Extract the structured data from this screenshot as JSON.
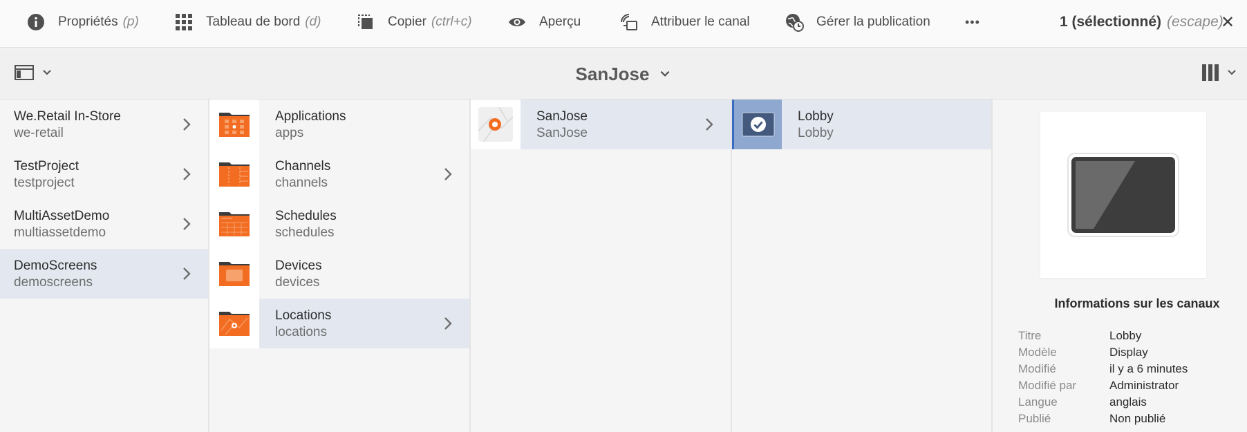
{
  "actionbar": {
    "properties": {
      "label": "Propriétés",
      "shortcut": "(p)",
      "icon": "info-icon"
    },
    "dashboard": {
      "label": "Tableau de bord",
      "shortcut": "(d)",
      "icon": "grid-icon"
    },
    "copy": {
      "label": "Copier",
      "shortcut": "(ctrl+c)",
      "icon": "copy-icon"
    },
    "preview": {
      "label": "Aperçu",
      "icon": "eye-icon"
    },
    "assign_channel": {
      "label": "Attribuer le canal",
      "icon": "assign-channel-icon"
    },
    "manage_publication": {
      "label": "Gérer la publication",
      "icon": "globe-clock-icon"
    },
    "more": {
      "label": "•••"
    },
    "selection": {
      "count": "1 (sélectionné)",
      "escape": "(escape)"
    },
    "close": {
      "label": "✕"
    }
  },
  "titlebar": {
    "title": "SanJose"
  },
  "columns": {
    "col1": [
      {
        "title": "We.Retail In-Store",
        "sub": "we-retail"
      },
      {
        "title": "TestProject",
        "sub": "testproject"
      },
      {
        "title": "MultiAssetDemo",
        "sub": "multiassetdemo"
      },
      {
        "title": "DemoScreens",
        "sub": "demoscreens"
      }
    ],
    "col2": [
      {
        "title": "Applications",
        "sub": "apps"
      },
      {
        "title": "Channels",
        "sub": "channels"
      },
      {
        "title": "Schedules",
        "sub": "schedules"
      },
      {
        "title": "Devices",
        "sub": "devices"
      },
      {
        "title": "Locations",
        "sub": "locations"
      }
    ],
    "col3": [
      {
        "title": "SanJose",
        "sub": "SanJose"
      }
    ],
    "col4": [
      {
        "title": "Lobby",
        "sub": "Lobby"
      }
    ]
  },
  "panel": {
    "heading": "Informations sur les canaux",
    "props": [
      {
        "key": "Titre",
        "value": "Lobby"
      },
      {
        "key": "Modèle",
        "value": "Display"
      },
      {
        "key": "Modifié",
        "value": "il y a 6 minutes"
      },
      {
        "key": "Modifié par",
        "value": "Administrator"
      },
      {
        "key": "Langue",
        "value": "anglais"
      },
      {
        "key": "Publié",
        "value": "Non publié"
      }
    ]
  },
  "colors": {
    "folder_orange": "#f26d21",
    "folder_dark": "#3c3c3c",
    "selected_blue": "#3a6bc4",
    "active_row": "#e3e8f0"
  }
}
